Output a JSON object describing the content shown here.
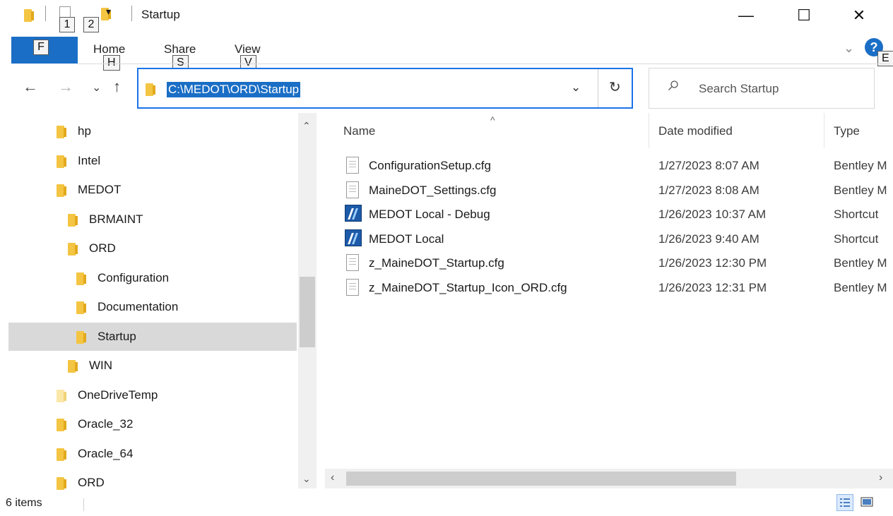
{
  "window": {
    "title": "Startup",
    "minimize_glyph": "—",
    "maximize_glyph": "☐",
    "close_glyph": "✕"
  },
  "quick_access": {
    "keytip_1": "1",
    "keytip_2": "2",
    "customize_glyph": "▾"
  },
  "ribbon": {
    "file_keytip": "F",
    "tabs": [
      {
        "label": "Home",
        "keytip": "H"
      },
      {
        "label": "Share",
        "keytip": "S"
      },
      {
        "label": "View",
        "keytip": "V"
      }
    ],
    "expand_glyph": "⌄",
    "help_keytip": "E"
  },
  "address": {
    "path": "C:\\MEDOT\\ORD\\Startup",
    "dropdown_glyph": "⌄",
    "refresh_glyph": "↻"
  },
  "nav": {
    "back_glyph": "←",
    "forward_glyph": "→",
    "recent_glyph": "⌄",
    "up_glyph": "↑"
  },
  "search": {
    "placeholder": "Search Startup"
  },
  "nav_pane": {
    "items": [
      {
        "label": "hp",
        "indent": 0,
        "selected": false
      },
      {
        "label": "Intel",
        "indent": 0,
        "selected": false
      },
      {
        "label": "MEDOT",
        "indent": 0,
        "selected": false
      },
      {
        "label": "BRMAINT",
        "indent": 1,
        "selected": false
      },
      {
        "label": "ORD",
        "indent": 1,
        "selected": false
      },
      {
        "label": "Configuration",
        "indent": 2,
        "selected": false
      },
      {
        "label": "Documentation",
        "indent": 2,
        "selected": false
      },
      {
        "label": "Startup",
        "indent": 2,
        "selected": true
      },
      {
        "label": "WIN",
        "indent": 1,
        "selected": false
      },
      {
        "label": "OneDriveTemp",
        "indent": 0,
        "selected": false,
        "pale": true
      },
      {
        "label": "Oracle_32",
        "indent": 0,
        "selected": false
      },
      {
        "label": "Oracle_64",
        "indent": 0,
        "selected": false
      },
      {
        "label": "ORD",
        "indent": 0,
        "selected": false
      }
    ]
  },
  "file_list": {
    "columns": {
      "name": "Name",
      "date": "Date modified",
      "type": "Type"
    },
    "sort_glyph": "^",
    "files": [
      {
        "name": "ConfigurationSetup.cfg",
        "date": "1/27/2023 8:07 AM",
        "type": "Bentley M",
        "icon": "cfg-file-icon"
      },
      {
        "name": "MaineDOT_Settings.cfg",
        "date": "1/27/2023 8:08 AM",
        "type": "Bentley M",
        "icon": "cfg-file-icon"
      },
      {
        "name": "MEDOT Local - Debug",
        "date": "1/26/2023 10:37 AM",
        "type": "Shortcut",
        "icon": "shortcut-icon"
      },
      {
        "name": "MEDOT Local",
        "date": "1/26/2023 9:40 AM",
        "type": "Shortcut",
        "icon": "shortcut-icon"
      },
      {
        "name": "z_MaineDOT_Startup.cfg",
        "date": "1/26/2023 12:30 PM",
        "type": "Bentley M",
        "icon": "cfg-file-icon"
      },
      {
        "name": "z_MaineDOT_Startup_Icon_ORD.cfg",
        "date": "1/26/2023 12:31 PM",
        "type": "Bentley M",
        "icon": "cfg-file-icon"
      }
    ]
  },
  "status": {
    "item_count": "6 items"
  },
  "colors": {
    "accent": "#1a6ec5",
    "folder": "#f4c542"
  }
}
